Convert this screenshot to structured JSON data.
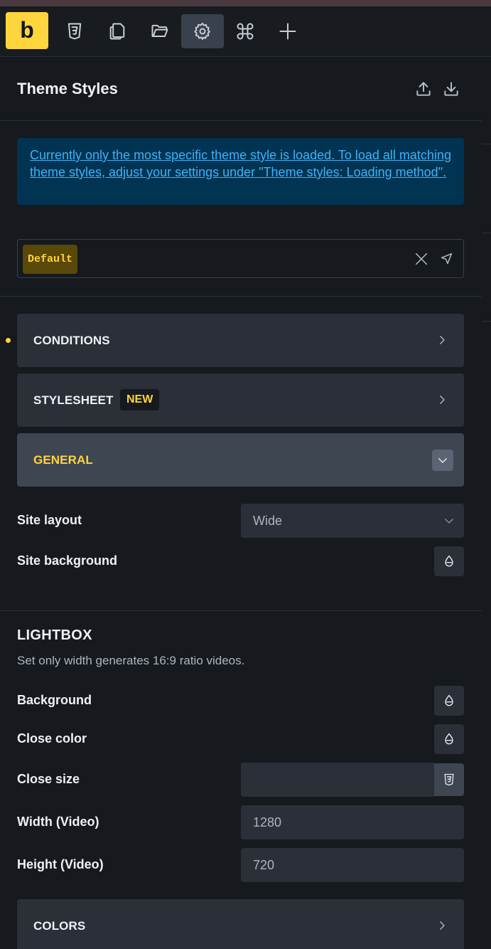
{
  "toolbar": {
    "logo_letter": "b",
    "buttons": [
      "css-icon",
      "pages-icon",
      "folder-icon",
      "settings-icon",
      "command-icon",
      "plus-icon"
    ],
    "active": "settings-icon",
    "accent": "#ffd53e"
  },
  "header": {
    "title": "Theme Styles",
    "actions": [
      "upload-icon",
      "download-icon"
    ]
  },
  "notice": {
    "text": "Currently only the most specific theme style is loaded. To load all matching theme styles, adjust your settings under \"Theme styles: Loading method\"."
  },
  "theme_style_select": {
    "selected": "Default"
  },
  "accordions": {
    "conditions": "CONDITIONS",
    "stylesheet": "STYLESHEET",
    "stylesheet_badge": "NEW",
    "general": "GENERAL",
    "colors": "COLORS"
  },
  "general": {
    "site_layout_label": "Site layout",
    "site_layout_value": "Wide",
    "site_background_label": "Site background"
  },
  "lightbox": {
    "title": "LIGHTBOX",
    "description": "Set only width generates 16:9 ratio videos.",
    "background_label": "Background",
    "close_color_label": "Close color",
    "close_size_label": "Close size",
    "close_size_value": "",
    "width_label": "Width (Video)",
    "width_value": "1280",
    "height_label": "Height (Video)",
    "height_value": "720"
  }
}
